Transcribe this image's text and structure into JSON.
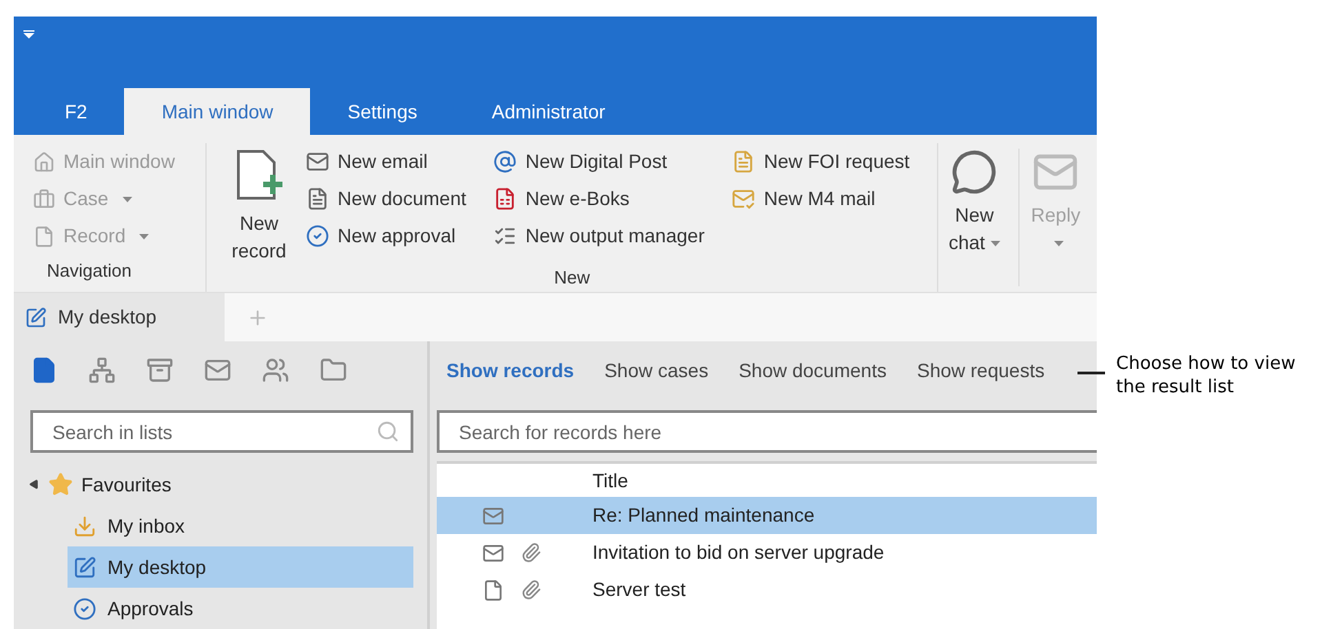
{
  "tabs": [
    {
      "label": "F2",
      "selected": false
    },
    {
      "label": "Main window",
      "selected": true
    },
    {
      "label": "Settings",
      "selected": false
    },
    {
      "label": "Administrator",
      "selected": false
    }
  ],
  "navigation": {
    "label": "Navigation",
    "items": [
      {
        "label": "Main window",
        "kind": "home",
        "disabled": true,
        "dropdown": false
      },
      {
        "label": "Case",
        "kind": "case",
        "disabled": true,
        "dropdown": true
      },
      {
        "label": "Record",
        "kind": "record",
        "disabled": true,
        "dropdown": true
      }
    ]
  },
  "new_group": {
    "label": "New",
    "large_button": {
      "label": "New record"
    },
    "columns": [
      [
        {
          "label": "New email",
          "kind": "email"
        },
        {
          "label": "New document",
          "kind": "document"
        },
        {
          "label": "New approval",
          "kind": "approval"
        }
      ],
      [
        {
          "label": "New Digital Post",
          "kind": "digital"
        },
        {
          "label": "New e-Boks",
          "kind": "eboks"
        },
        {
          "label": "New output manager",
          "kind": "output"
        }
      ],
      [
        {
          "label": "New FOI request",
          "kind": "foi"
        },
        {
          "label": "New M4 mail",
          "kind": "m4"
        }
      ]
    ]
  },
  "chat_button": {
    "label": "New chat",
    "dropdown": true,
    "disabled": false
  },
  "reply_button": {
    "label": "Reply",
    "dropdown": true,
    "disabled": true
  },
  "doc_tabs": [
    {
      "label": "My desktop",
      "selected": true
    }
  ],
  "list_types": [
    {
      "kind": "records",
      "selected": true
    },
    {
      "kind": "cases",
      "selected": false
    },
    {
      "kind": "cabinet",
      "selected": false
    },
    {
      "kind": "mail",
      "selected": false
    },
    {
      "kind": "people",
      "selected": false
    },
    {
      "kind": "folder",
      "selected": false
    }
  ],
  "list_search": {
    "placeholder": "Search in lists"
  },
  "tree": [
    {
      "label": "Favourites",
      "kind": "star",
      "expanded": true,
      "selected": false,
      "children": [
        {
          "label": "My inbox",
          "kind": "inbox",
          "selected": false
        },
        {
          "label": "My desktop",
          "kind": "desktop",
          "selected": true
        },
        {
          "label": "Approvals",
          "kind": "approval",
          "selected": false
        }
      ]
    }
  ],
  "result_views": [
    {
      "label": "Show records",
      "selected": true
    },
    {
      "label": "Show cases",
      "selected": false
    },
    {
      "label": "Show documents",
      "selected": false
    },
    {
      "label": "Show requests",
      "selected": false
    }
  ],
  "record_search": {
    "placeholder": "Search for records here"
  },
  "table": {
    "columns": [
      "Title"
    ],
    "rows": [
      {
        "kind": "email",
        "attachment": false,
        "title": "Re: Planned maintenance",
        "selected": true
      },
      {
        "kind": "email",
        "attachment": true,
        "title": "Invitation to bid on server upgrade",
        "selected": false
      },
      {
        "kind": "document",
        "attachment": true,
        "title": "Server test",
        "selected": false
      }
    ]
  },
  "callout": "Choose how to view the result list"
}
